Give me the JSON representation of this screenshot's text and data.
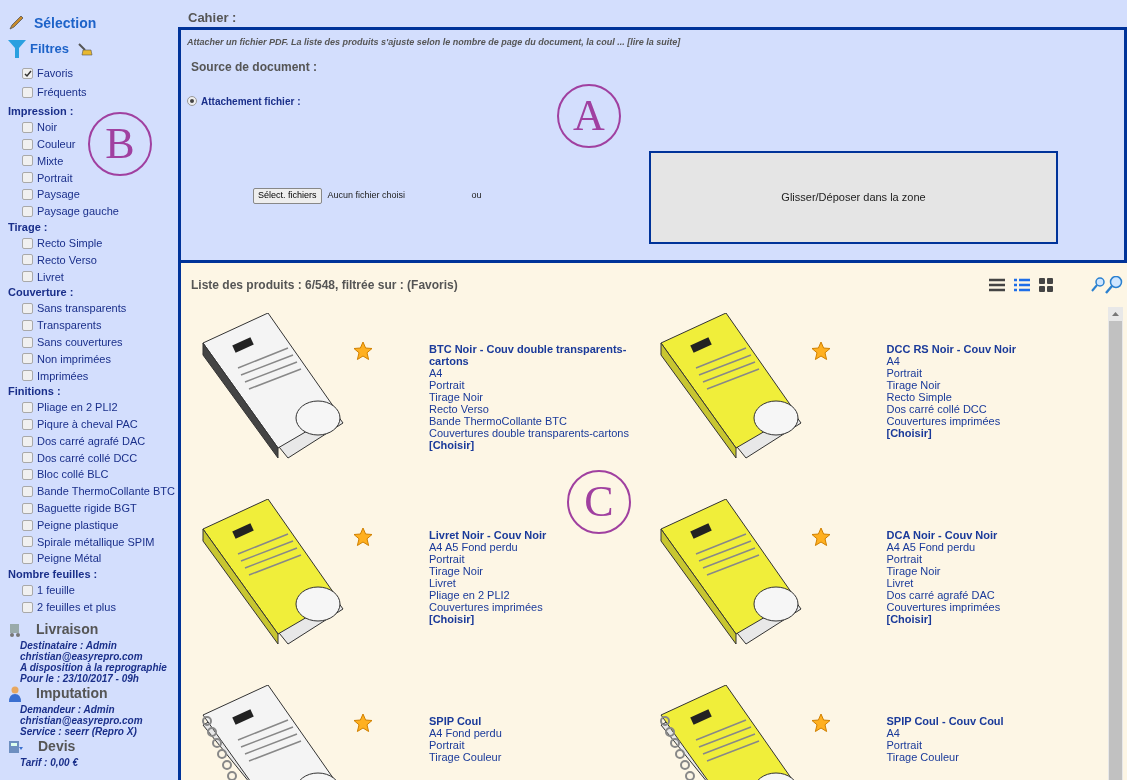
{
  "sidebar": {
    "selection_title": "Sélection",
    "filters_title": "Filtres",
    "filter_groups": [
      {
        "items": [
          {
            "label": "Favoris",
            "checked": true
          },
          {
            "label": "Fréquents",
            "checked": false
          }
        ]
      },
      {
        "heading": "Impression :",
        "items": [
          {
            "label": "Noir",
            "checked": false
          },
          {
            "label": "Couleur",
            "checked": false
          },
          {
            "label": "Mixte",
            "checked": false
          },
          {
            "label": "Portrait",
            "checked": false
          },
          {
            "label": "Paysage",
            "checked": false
          },
          {
            "label": "Paysage gauche",
            "checked": false
          }
        ]
      },
      {
        "heading": "Tirage :",
        "items": [
          {
            "label": "Recto Simple",
            "checked": false
          },
          {
            "label": "Recto Verso",
            "checked": false
          },
          {
            "label": "Livret",
            "checked": false
          }
        ]
      },
      {
        "heading": "Couverture :",
        "items": [
          {
            "label": "Sans transparents",
            "checked": false
          },
          {
            "label": "Transparents",
            "checked": false
          },
          {
            "label": "Sans couvertures",
            "checked": false
          },
          {
            "label": "Non imprimées",
            "checked": false
          },
          {
            "label": "Imprimées",
            "checked": false
          }
        ]
      },
      {
        "heading": "Finitions :",
        "items": [
          {
            "label": "Pliage en 2 PLI2",
            "checked": false
          },
          {
            "label": "Piqure à cheval PAC",
            "checked": false
          },
          {
            "label": "Dos carré agrafé DAC",
            "checked": false
          },
          {
            "label": "Dos carré collé DCC",
            "checked": false
          },
          {
            "label": "Bloc collé BLC",
            "checked": false
          },
          {
            "label": "Bande ThermoCollante BTC",
            "checked": false
          },
          {
            "label": "Baguette rigide BGT",
            "checked": false
          },
          {
            "label": "Peigne plastique",
            "checked": false
          },
          {
            "label": "Spirale métallique SPIM",
            "checked": false
          },
          {
            "label": "Peigne Métal",
            "checked": false
          }
        ]
      },
      {
        "heading": "Nombre feuilles :",
        "items": [
          {
            "label": "1 feuille",
            "checked": false
          },
          {
            "label": "2 feuilles et plus",
            "checked": false
          }
        ]
      }
    ],
    "info_sections": [
      {
        "kind": "delivery",
        "title": "Livraison",
        "lines": [
          "Destinataire : Admin",
          "christian@easyrepro.com",
          "A disposition à la reprographie",
          "Pour le : 23/10/2017 - 09h"
        ]
      },
      {
        "kind": "person",
        "title": "Imputation",
        "lines": [
          "Demandeur : Admin",
          "christian@easyrepro.com",
          "Service : seerr (Repro X)"
        ]
      },
      {
        "kind": "quote",
        "title": "Devis",
        "lines": [
          "Tarif : 0,00 €"
        ]
      }
    ]
  },
  "header": "Cahier :",
  "document_panel": {
    "hint": "Attacher un fichier PDF. La liste des produits s'ajuste selon le nombre de page du document, la coul ...",
    "read_more": "[lire la suite]",
    "title": "Source de document :",
    "option": {
      "label": "Attachement fichier :",
      "selected": true
    },
    "file_button": "Sélect. fichiers",
    "file_status": "Aucun fichier choisi",
    "or": "ou",
    "drop_zone": "Glisser/Déposer dans la zone"
  },
  "products": {
    "title": "Liste des produits : 6/548, filtrée sur : (Favoris)",
    "views": [
      {
        "kind": "list",
        "selected": false
      },
      {
        "kind": "details",
        "selected": true
      },
      {
        "kind": "grid",
        "selected": false
      }
    ],
    "items": [
      {
        "kind": "thermal",
        "name": "BTC Noir - Couv double transparents-cartons",
        "lines": [
          "A4",
          "Portrait",
          "Tirage Noir",
          "Recto Verso",
          "Bande ThermoCollante BTC",
          "Couvertures double transparents-cartons"
        ],
        "action": "[Choisir]"
      },
      {
        "kind": "glued",
        "name": "DCC RS Noir - Couv Noir",
        "lines": [
          "A4",
          "Portrait",
          "Tirage Noir",
          "Recto Simple",
          "Dos carré collé DCC",
          "Couvertures imprimées"
        ],
        "action": "[Choisir]"
      },
      {
        "kind": "glued",
        "name": "Livret Noir - Couv Noir",
        "lines": [
          "A4 A5 Fond perdu",
          "Portrait",
          "Tirage Noir",
          "Livret",
          "Pliage en 2 PLI2",
          "Couvertures imprimées"
        ],
        "action": "[Choisir]"
      },
      {
        "kind": "glued",
        "name": "DCA Noir - Couv Noir",
        "lines": [
          "A4 A5 Fond perdu",
          "Portrait",
          "Tirage Noir",
          "Livret",
          "Dos carré agrafé DAC",
          "Couvertures imprimées"
        ],
        "action": "[Choisir]"
      },
      {
        "kind": "wire",
        "name": "SPIP Coul",
        "lines": [
          "A4 Fond perdu",
          "Portrait",
          "Tirage Couleur"
        ]
      },
      {
        "kind": "spiral",
        "name": "SPIP Coul - Couv Coul",
        "lines": [
          "A4",
          "Portrait",
          "Tirage Couleur"
        ]
      }
    ]
  },
  "annotations": [
    "A",
    "B",
    "C"
  ]
}
